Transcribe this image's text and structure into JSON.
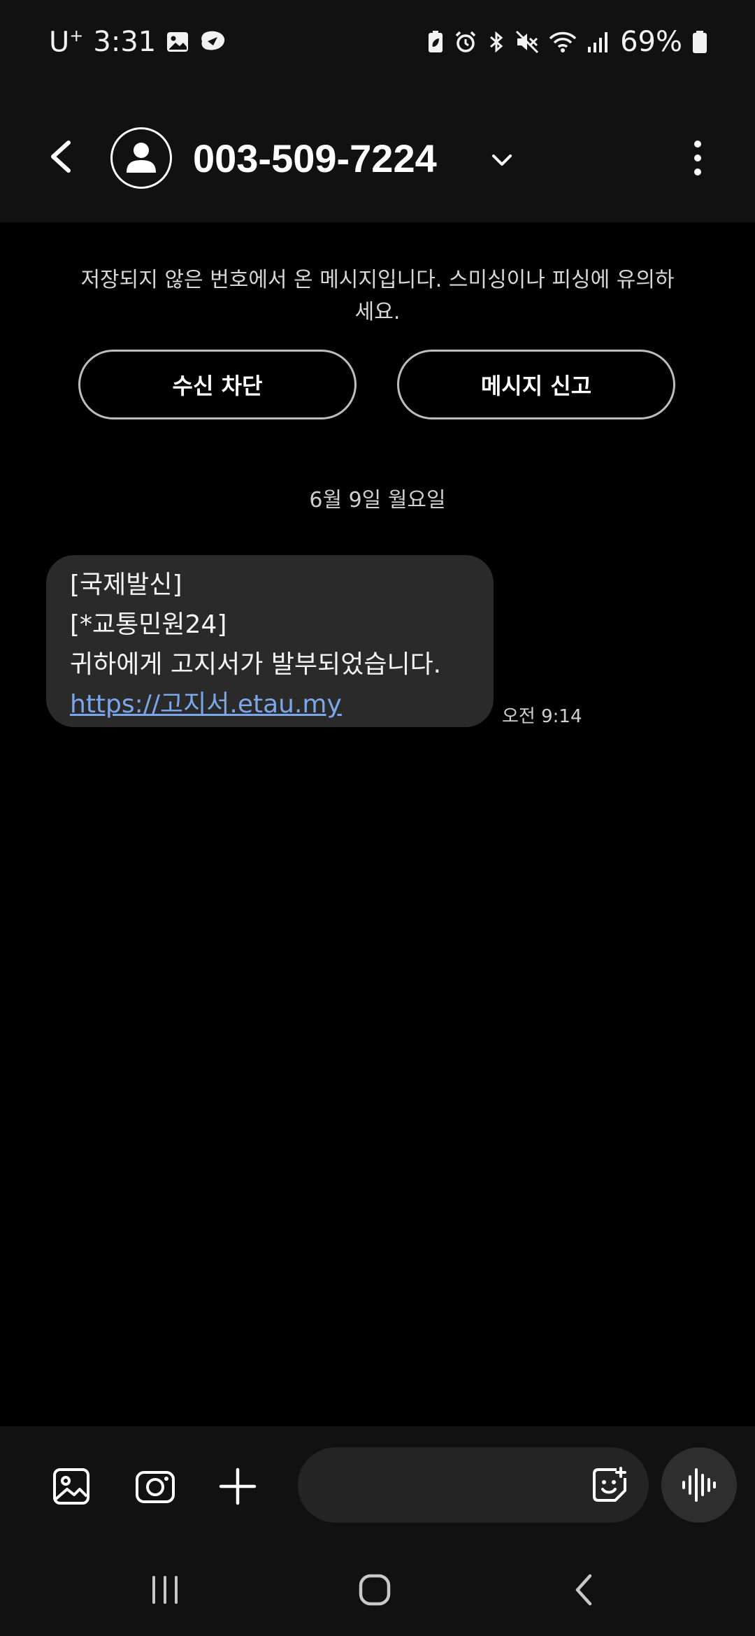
{
  "status_bar": {
    "carrier": "U",
    "carrier_sup": "+",
    "time": "3:31",
    "battery": "69%"
  },
  "header": {
    "contact": "003-509-7224",
    "icons": [
      "back-arrow-icon",
      "person-icon",
      "chevron-down-icon",
      "more-vert-icon"
    ]
  },
  "warning": {
    "text": "저장되지 않은 번호에서 온 메시지입니다. 스미싱이나 피싱에 유의하세요.",
    "block_button": "수신 차단",
    "report_button": "메시지 신고"
  },
  "conversation": {
    "date": "6월 9일 월요일",
    "messages": [
      {
        "lines": [
          "[국제발신]",
          "[*교통민원24]",
          "귀하에게 고지서가 발부되었습니다."
        ],
        "link": "https://고지서.etau.my",
        "time": "오전 9:14"
      }
    ]
  },
  "composer": {
    "placeholder": "",
    "icons": [
      "gallery-icon",
      "camera-icon",
      "plus-icon",
      "sticker-icon",
      "voice-icon"
    ]
  },
  "navbar": {
    "icons": [
      "recents-icon",
      "home-icon",
      "back-icon"
    ]
  },
  "colors": {
    "background": "#000000",
    "header": "#111111",
    "bubble": "#2a2a2a",
    "link": "#7ba7ea"
  }
}
